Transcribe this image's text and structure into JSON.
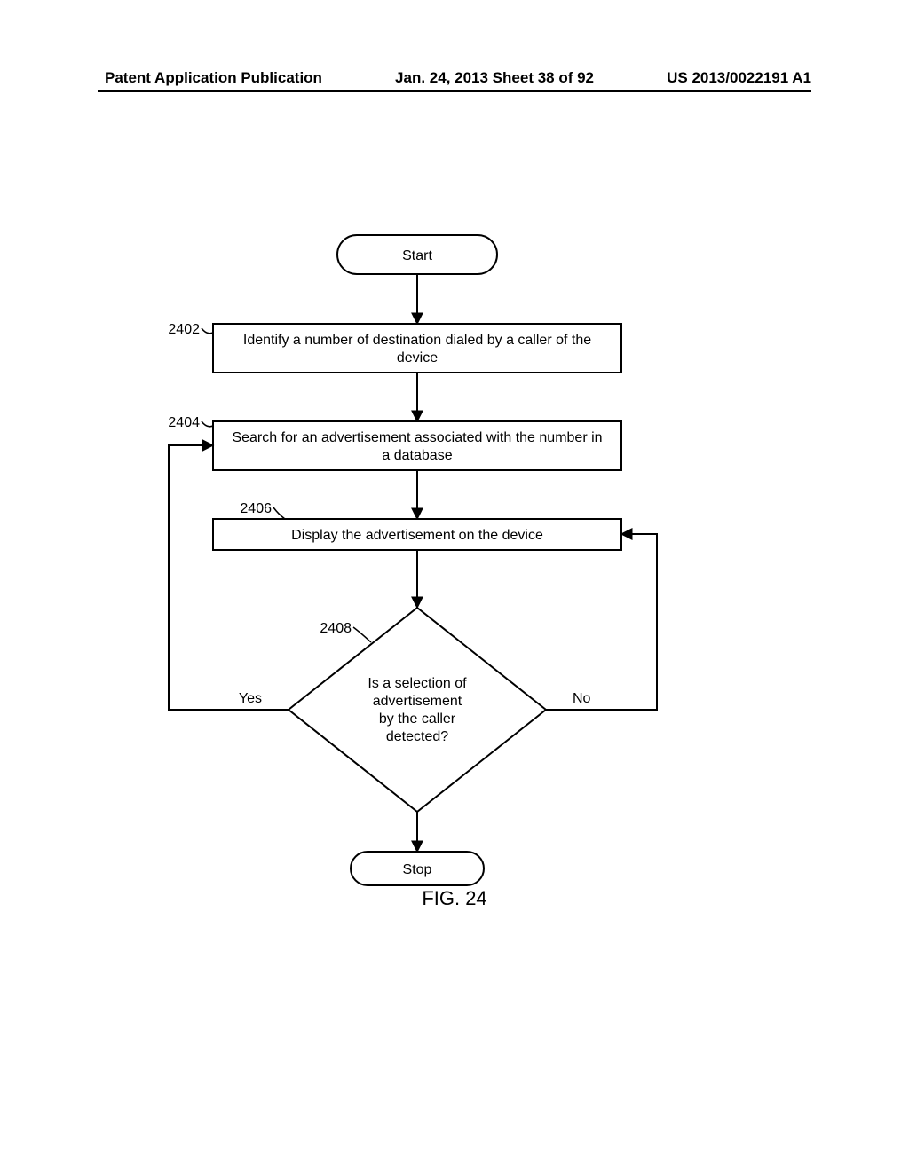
{
  "header": {
    "left": "Patent Application Publication",
    "mid": "Jan. 24, 2013  Sheet 38 of 92",
    "right": "US 2013/0022191 A1"
  },
  "flow": {
    "start": "Start",
    "step1": {
      "ref": "2402",
      "text1": "Identify a number of destination dialed by a caller of the",
      "text2": "device"
    },
    "step2": {
      "ref": "2404",
      "text1": "Search for an advertisement associated with the number in",
      "text2": "a database"
    },
    "step3": {
      "ref": "2406",
      "text1": "Display the advertisement on the device"
    },
    "dec": {
      "ref": "2408",
      "l1": "Is a selection of",
      "l2": "advertisement",
      "l3": "by the caller",
      "l4": "detected?"
    },
    "yes": "Yes",
    "no": "No",
    "stop": "Stop"
  },
  "figure_label": "FIG. 24"
}
